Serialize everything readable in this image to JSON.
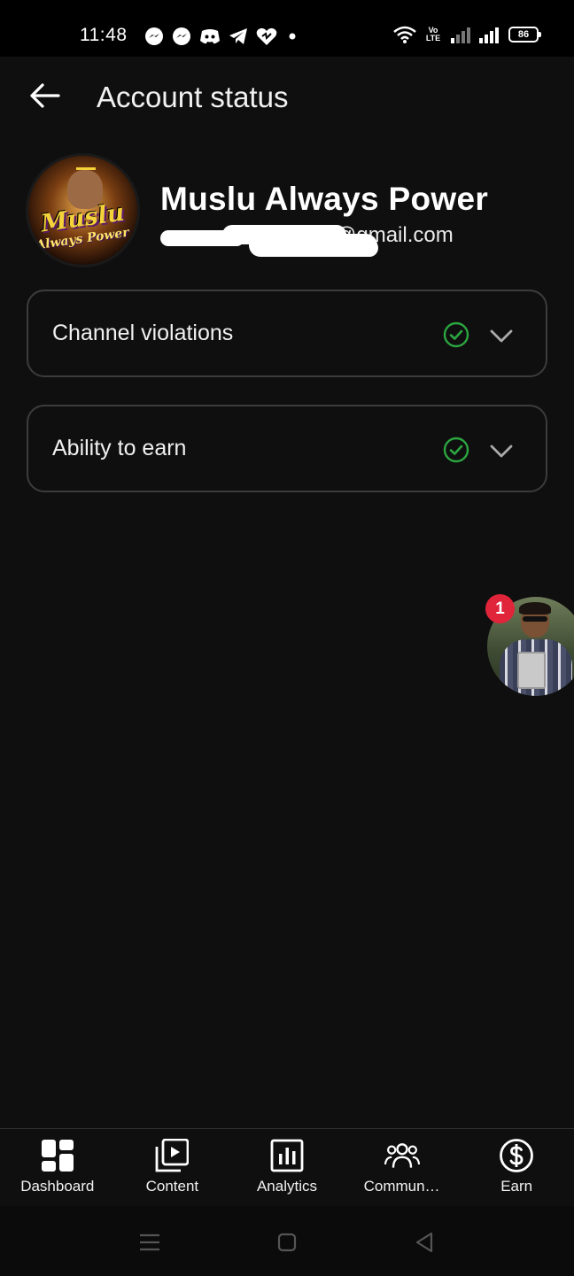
{
  "status_bar": {
    "time": "11:48",
    "notification_icons": [
      "messenger-icon",
      "messenger-icon",
      "discord-icon",
      "telegram-icon",
      "heart-app-icon",
      "dot-icon"
    ],
    "volte": "Vo LTE",
    "battery": "86"
  },
  "header": {
    "title": "Account status",
    "back_icon": "arrow-left-icon"
  },
  "profile": {
    "channel_name": "Muslu Always Power",
    "email_suffix": "@gmail.com",
    "avatar_text_line1": "Muslu",
    "avatar_text_line2": "Always Power"
  },
  "cards": [
    {
      "label": "Channel violations",
      "status_icon": "check-circle-icon",
      "status_color": "#2ba640"
    },
    {
      "label": "Ability to earn",
      "status_icon": "check-circle-icon",
      "status_color": "#2ba640"
    }
  ],
  "floating_bubble": {
    "badge_count": "1"
  },
  "bottom_nav": {
    "items": [
      {
        "label": "Dashboard",
        "icon": "dashboard-icon"
      },
      {
        "label": "Content",
        "icon": "content-icon"
      },
      {
        "label": "Analytics",
        "icon": "analytics-icon"
      },
      {
        "label": "Commun…",
        "icon": "community-icon"
      },
      {
        "label": "Earn",
        "icon": "earn-dollar-icon"
      }
    ]
  },
  "system_nav": {
    "buttons": [
      "menu-icon",
      "home-icon",
      "back-triangle-icon"
    ]
  },
  "colors": {
    "background": "#0f0f0f",
    "text": "#f1f1f1",
    "card_border": "#3c3c3c",
    "success_green": "#2ba640",
    "badge_red": "#e0243a"
  }
}
